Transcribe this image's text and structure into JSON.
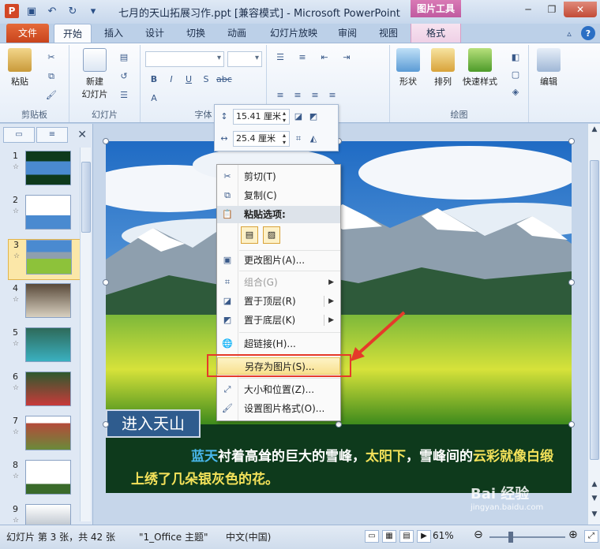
{
  "window": {
    "title": "七月的天山拓展习作.ppt [兼容模式] - Microsoft PowerPoint",
    "context_tab_group": "图片工具",
    "app_icon_letter": "P"
  },
  "ribbon_tabs": [
    "文件",
    "开始",
    "插入",
    "设计",
    "切换",
    "动画",
    "幻灯片放映",
    "审阅",
    "视图",
    "格式"
  ],
  "ribbon": {
    "clipboard": {
      "paste": "粘贴",
      "group": "剪贴板"
    },
    "slides": {
      "new_slide": "新建\n幻灯片",
      "group": "幻灯片"
    },
    "font": {
      "group": "字体"
    },
    "drawing": {
      "shape": "形状",
      "arrange": "排列",
      "quick_styles": "快速样式",
      "group": "绘图"
    },
    "editing": {
      "edit": "编辑"
    }
  },
  "size_popup": {
    "height": "15.41 厘米",
    "width": "25.4 厘米"
  },
  "slide_panel": {
    "slides": [
      {
        "num": "1"
      },
      {
        "num": "2"
      },
      {
        "num": "3"
      },
      {
        "num": "4"
      },
      {
        "num": "5"
      },
      {
        "num": "6"
      },
      {
        "num": "7"
      },
      {
        "num": "8"
      },
      {
        "num": "9"
      }
    ],
    "selected": 3
  },
  "slide": {
    "caption": "进入天山",
    "text_segments": [
      {
        "text": "蓝天",
        "style": "c1"
      },
      {
        "text": "衬着高耸的巨大的雪峰，",
        "style": "plain"
      },
      {
        "text": "太阳下",
        "style": "c2"
      },
      {
        "text": "，雪峰间的",
        "style": "plain"
      },
      {
        "text": "云彩",
        "style": "c2"
      },
      {
        "text": "就像白缎上绣了几朵银灰色的花。",
        "style": "c2"
      }
    ]
  },
  "context_menu": {
    "cut": "剪切(T)",
    "copy": "复制(C)",
    "paste_options": "粘贴选项:",
    "change_picture": "更改图片(A)...",
    "group": "组合(G)",
    "bring_front": "置于顶层(R)",
    "send_back": "置于底层(K)",
    "hyperlink": "超链接(H)...",
    "save_as_picture": "另存为图片(S)...",
    "size_position": "大小和位置(Z)...",
    "format_picture": "设置图片格式(O)..."
  },
  "status": {
    "slide_info": "幻灯片 第 3 张，共 42 张",
    "theme": "\"1_Office 主题\"",
    "language": "中文(中国)",
    "zoom": "61%",
    "zoom_level": 0.61
  },
  "watermark": {
    "brand": "Bai 经验",
    "url": "jingyan.baidu.com"
  },
  "colors": {
    "accent_file_tab": "#d24726",
    "highlight_red": "#e53a2a",
    "caption_blue": "#2f5c8e"
  }
}
